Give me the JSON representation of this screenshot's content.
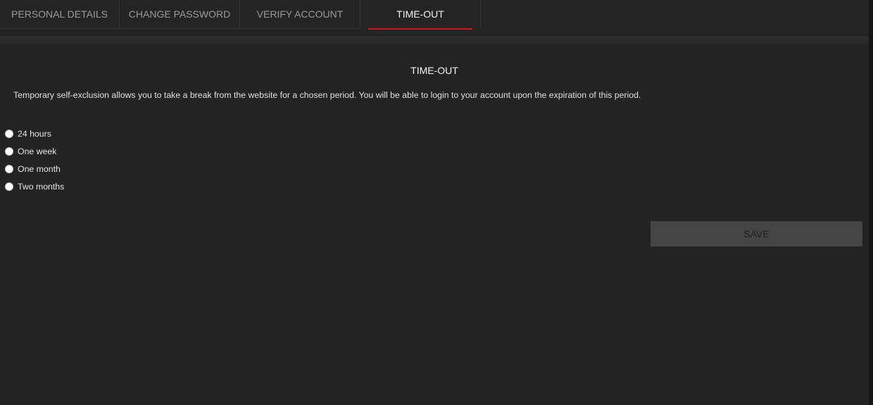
{
  "tabs": [
    {
      "label": "PERSONAL DETAILS"
    },
    {
      "label": "CHANGE PASSWORD"
    },
    {
      "label": "VERIFY ACCOUNT"
    },
    {
      "label": "TIME-OUT"
    }
  ],
  "active_tab": "TIME-OUT",
  "section": {
    "title": "TIME-OUT",
    "description": "Temporary self-exclusion allows you to take a break from the website for a chosen period. You will be able to login to your account upon the expiration of this period."
  },
  "options": [
    {
      "label": "24 hours",
      "selected": false
    },
    {
      "label": "One week",
      "selected": false
    },
    {
      "label": "One month",
      "selected": false
    },
    {
      "label": "Two months",
      "selected": false
    }
  ],
  "save_label": "SAVE",
  "colors": {
    "accent": "#d3151e",
    "background": "#232323",
    "button": "#454545"
  }
}
